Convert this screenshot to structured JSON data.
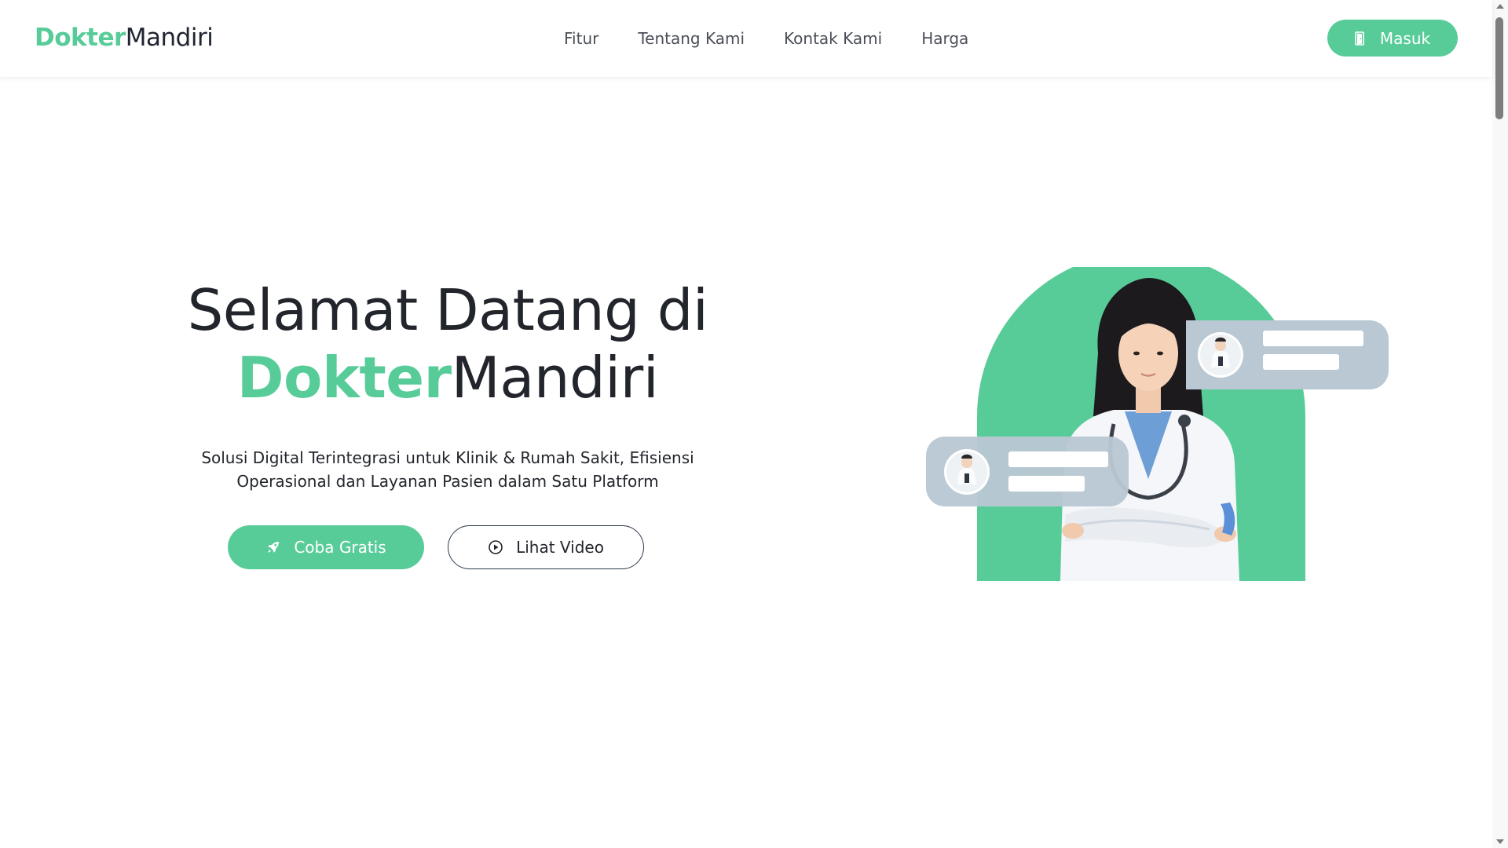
{
  "brand": {
    "part1": "Dokter",
    "part2": "Mandiri"
  },
  "nav": {
    "items": [
      {
        "label": "Fitur"
      },
      {
        "label": "Tentang Kami"
      },
      {
        "label": "Kontak Kami"
      },
      {
        "label": "Harga"
      }
    ],
    "login_label": "Masuk"
  },
  "hero": {
    "title_line1": "Selamat Datang di",
    "title_brand_part1": "Dokter",
    "title_brand_part2": "Mandiri",
    "subtitle": "Solusi Digital Terintegrasi untuk Klinik & Rumah Sakit, Efisiensi Operasional dan Layanan Pasien dalam Satu Platform",
    "primary_cta": "Coba Gratis",
    "secondary_cta": "Lihat Video"
  },
  "colors": {
    "accent": "#58cc98",
    "text": "#22252b",
    "chat_bubble": "#b9c8d3",
    "chat_line": "#ffffff"
  },
  "icons": {
    "login": "door-icon",
    "primary_cta": "rocket-icon",
    "secondary_cta": "play-circle-icon"
  }
}
